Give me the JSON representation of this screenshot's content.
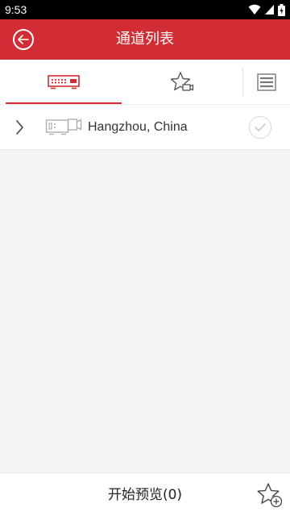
{
  "status_bar": {
    "time": "9:53",
    "icons": [
      "wifi-icon",
      "signal-icon",
      "battery-icon"
    ]
  },
  "app_bar": {
    "title": "通道列表",
    "back_icon": "back-arrow-icon",
    "color": "#d22c34"
  },
  "tabs": [
    {
      "name": "device",
      "icon": "device-recorder-icon",
      "selected": true
    },
    {
      "name": "favorites",
      "icon": "star-camera-icon",
      "selected": false
    },
    {
      "name": "list",
      "icon": "list-icon",
      "selected": false
    }
  ],
  "devices": [
    {
      "name": "Hangzhou, China",
      "icon": "recorder-icon",
      "expand_icon": "chevron-right-icon",
      "checked": false
    }
  ],
  "bottom_bar": {
    "start_preview_label": "开始预览(0)",
    "add_favorite_icon": "star-add-icon"
  },
  "colors": {
    "accent": "#d22c34",
    "background": "#f3f3f3"
  }
}
